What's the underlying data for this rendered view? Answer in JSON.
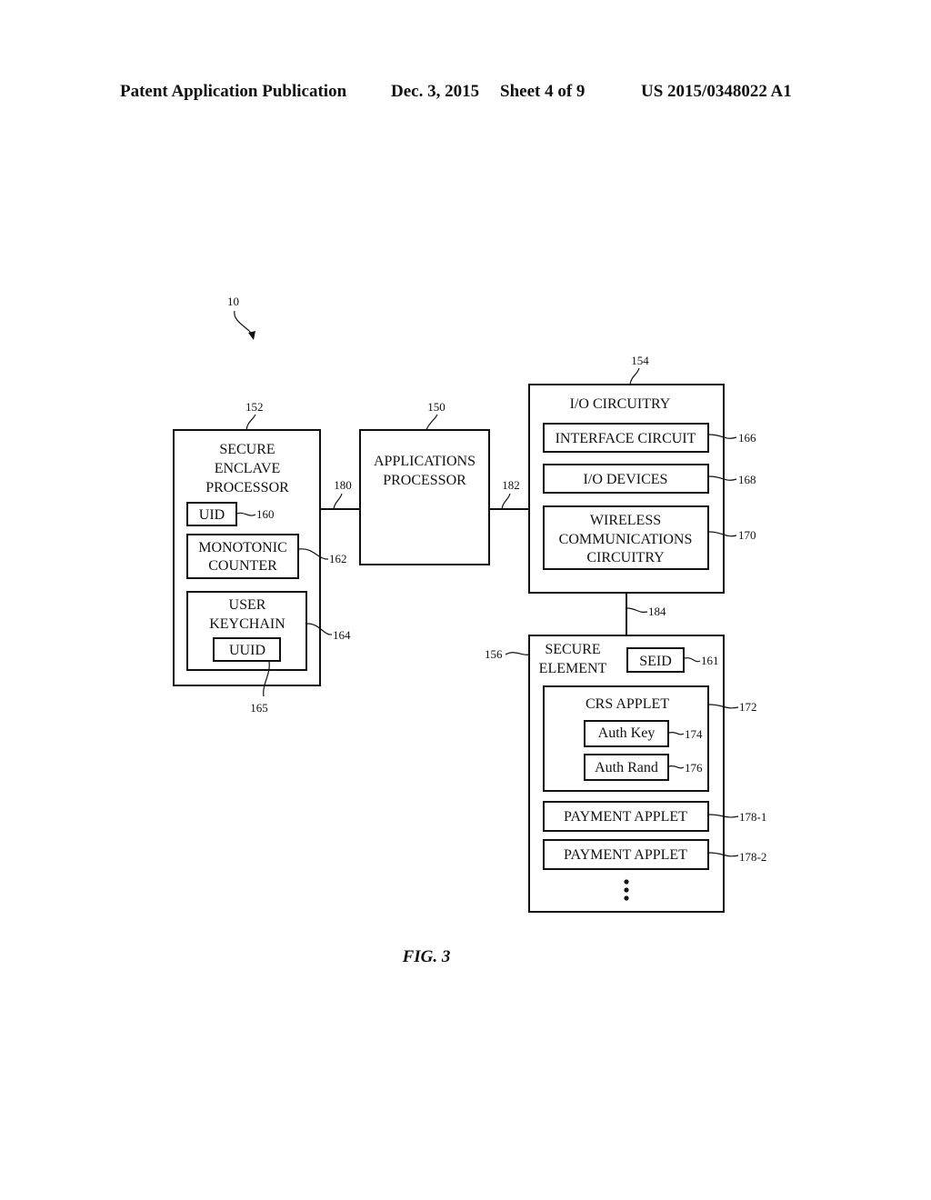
{
  "header": {
    "left": "Patent Application Publication",
    "date": "Dec. 3, 2015",
    "sheet": "Sheet 4 of 9",
    "number": "US 2015/0348022 A1"
  },
  "figure": {
    "caption": "FIG. 3",
    "device_ref": "10",
    "secure_enclave": {
      "ref": "152",
      "title": [
        "SECURE",
        "ENCLAVE",
        "PROCESSOR"
      ],
      "uid": {
        "label": "UID",
        "ref": "160"
      },
      "counter": {
        "label": [
          "MONOTONIC",
          "COUNTER"
        ],
        "ref": "162"
      },
      "keychain": {
        "label": [
          "USER",
          "KEYCHAIN"
        ],
        "ref": "164"
      },
      "uuid": {
        "label": "UUID",
        "ref": "165"
      }
    },
    "apps_processor": {
      "ref": "150",
      "title": [
        "APPLICATIONS",
        "PROCESSOR"
      ]
    },
    "links": {
      "left": "180",
      "right": "182",
      "down": "184"
    },
    "io": {
      "ref": "154",
      "title": "I/O CIRCUITRY",
      "interface": {
        "label": "INTERFACE CIRCUIT",
        "ref": "166"
      },
      "devices": {
        "label": "I/O DEVICES",
        "ref": "168"
      },
      "wireless": {
        "label": [
          "WIRELESS",
          "COMMUNICATIONS",
          "CIRCUITRY"
        ],
        "ref": "170"
      }
    },
    "secure_element": {
      "ref": "156",
      "title": [
        "SECURE",
        "ELEMENT"
      ],
      "seid": {
        "label": "SEID",
        "ref": "161"
      },
      "crs": {
        "label": "CRS APPLET",
        "ref": "172"
      },
      "auth_key": {
        "label": "Auth Key",
        "ref": "174"
      },
      "auth_rand": {
        "label": "Auth Rand",
        "ref": "176"
      },
      "payment1": {
        "label": "PAYMENT APPLET",
        "ref": "178-1"
      },
      "payment2": {
        "label": "PAYMENT APPLET",
        "ref": "178-2"
      }
    }
  }
}
